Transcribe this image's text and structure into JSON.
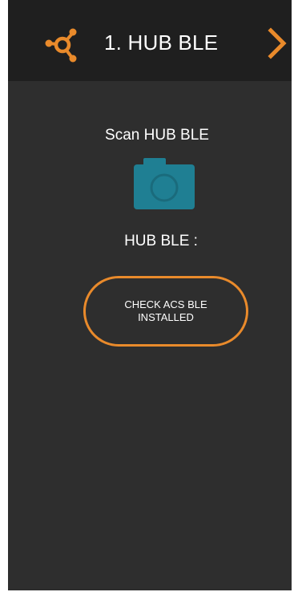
{
  "header": {
    "title": "1. HUB BLE",
    "logo_icon": "hub-nodes-icon",
    "next_icon": "chevron-right-icon"
  },
  "main": {
    "scan_label": "Scan HUB BLE",
    "camera_icon": "camera-icon",
    "hub_value_label": "HUB BLE :",
    "check_button_label": "CHECK ACS BLE\nINSTALLED"
  },
  "colors": {
    "accent": "#e98a2b",
    "camera": "#1f7f93",
    "background": "#2e2e2e",
    "header_background": "#1f1f1f",
    "text": "#ffffff"
  }
}
